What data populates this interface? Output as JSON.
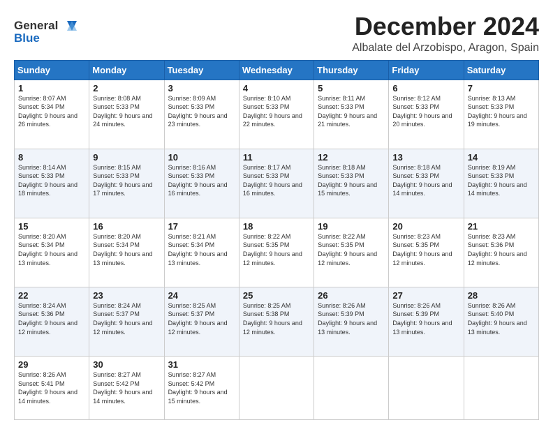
{
  "logo": {
    "line1": "General",
    "line2": "Blue"
  },
  "header": {
    "month": "December 2024",
    "location": "Albalate del Arzobispo, Aragon, Spain"
  },
  "columns": [
    "Sunday",
    "Monday",
    "Tuesday",
    "Wednesday",
    "Thursday",
    "Friday",
    "Saturday"
  ],
  "weeks": [
    [
      {
        "day": "1",
        "sunrise": "Sunrise: 8:07 AM",
        "sunset": "Sunset: 5:34 PM",
        "daylight": "Daylight: 9 hours and 26 minutes."
      },
      {
        "day": "2",
        "sunrise": "Sunrise: 8:08 AM",
        "sunset": "Sunset: 5:33 PM",
        "daylight": "Daylight: 9 hours and 24 minutes."
      },
      {
        "day": "3",
        "sunrise": "Sunrise: 8:09 AM",
        "sunset": "Sunset: 5:33 PM",
        "daylight": "Daylight: 9 hours and 23 minutes."
      },
      {
        "day": "4",
        "sunrise": "Sunrise: 8:10 AM",
        "sunset": "Sunset: 5:33 PM",
        "daylight": "Daylight: 9 hours and 22 minutes."
      },
      {
        "day": "5",
        "sunrise": "Sunrise: 8:11 AM",
        "sunset": "Sunset: 5:33 PM",
        "daylight": "Daylight: 9 hours and 21 minutes."
      },
      {
        "day": "6",
        "sunrise": "Sunrise: 8:12 AM",
        "sunset": "Sunset: 5:33 PM",
        "daylight": "Daylight: 9 hours and 20 minutes."
      },
      {
        "day": "7",
        "sunrise": "Sunrise: 8:13 AM",
        "sunset": "Sunset: 5:33 PM",
        "daylight": "Daylight: 9 hours and 19 minutes."
      }
    ],
    [
      {
        "day": "8",
        "sunrise": "Sunrise: 8:14 AM",
        "sunset": "Sunset: 5:33 PM",
        "daylight": "Daylight: 9 hours and 18 minutes."
      },
      {
        "day": "9",
        "sunrise": "Sunrise: 8:15 AM",
        "sunset": "Sunset: 5:33 PM",
        "daylight": "Daylight: 9 hours and 17 minutes."
      },
      {
        "day": "10",
        "sunrise": "Sunrise: 8:16 AM",
        "sunset": "Sunset: 5:33 PM",
        "daylight": "Daylight: 9 hours and 16 minutes."
      },
      {
        "day": "11",
        "sunrise": "Sunrise: 8:17 AM",
        "sunset": "Sunset: 5:33 PM",
        "daylight": "Daylight: 9 hours and 16 minutes."
      },
      {
        "day": "12",
        "sunrise": "Sunrise: 8:18 AM",
        "sunset": "Sunset: 5:33 PM",
        "daylight": "Daylight: 9 hours and 15 minutes."
      },
      {
        "day": "13",
        "sunrise": "Sunrise: 8:18 AM",
        "sunset": "Sunset: 5:33 PM",
        "daylight": "Daylight: 9 hours and 14 minutes."
      },
      {
        "day": "14",
        "sunrise": "Sunrise: 8:19 AM",
        "sunset": "Sunset: 5:33 PM",
        "daylight": "Daylight: 9 hours and 14 minutes."
      }
    ],
    [
      {
        "day": "15",
        "sunrise": "Sunrise: 8:20 AM",
        "sunset": "Sunset: 5:34 PM",
        "daylight": "Daylight: 9 hours and 13 minutes."
      },
      {
        "day": "16",
        "sunrise": "Sunrise: 8:20 AM",
        "sunset": "Sunset: 5:34 PM",
        "daylight": "Daylight: 9 hours and 13 minutes."
      },
      {
        "day": "17",
        "sunrise": "Sunrise: 8:21 AM",
        "sunset": "Sunset: 5:34 PM",
        "daylight": "Daylight: 9 hours and 13 minutes."
      },
      {
        "day": "18",
        "sunrise": "Sunrise: 8:22 AM",
        "sunset": "Sunset: 5:35 PM",
        "daylight": "Daylight: 9 hours and 12 minutes."
      },
      {
        "day": "19",
        "sunrise": "Sunrise: 8:22 AM",
        "sunset": "Sunset: 5:35 PM",
        "daylight": "Daylight: 9 hours and 12 minutes."
      },
      {
        "day": "20",
        "sunrise": "Sunrise: 8:23 AM",
        "sunset": "Sunset: 5:35 PM",
        "daylight": "Daylight: 9 hours and 12 minutes."
      },
      {
        "day": "21",
        "sunrise": "Sunrise: 8:23 AM",
        "sunset": "Sunset: 5:36 PM",
        "daylight": "Daylight: 9 hours and 12 minutes."
      }
    ],
    [
      {
        "day": "22",
        "sunrise": "Sunrise: 8:24 AM",
        "sunset": "Sunset: 5:36 PM",
        "daylight": "Daylight: 9 hours and 12 minutes."
      },
      {
        "day": "23",
        "sunrise": "Sunrise: 8:24 AM",
        "sunset": "Sunset: 5:37 PM",
        "daylight": "Daylight: 9 hours and 12 minutes."
      },
      {
        "day": "24",
        "sunrise": "Sunrise: 8:25 AM",
        "sunset": "Sunset: 5:37 PM",
        "daylight": "Daylight: 9 hours and 12 minutes."
      },
      {
        "day": "25",
        "sunrise": "Sunrise: 8:25 AM",
        "sunset": "Sunset: 5:38 PM",
        "daylight": "Daylight: 9 hours and 12 minutes."
      },
      {
        "day": "26",
        "sunrise": "Sunrise: 8:26 AM",
        "sunset": "Sunset: 5:39 PM",
        "daylight": "Daylight: 9 hours and 13 minutes."
      },
      {
        "day": "27",
        "sunrise": "Sunrise: 8:26 AM",
        "sunset": "Sunset: 5:39 PM",
        "daylight": "Daylight: 9 hours and 13 minutes."
      },
      {
        "day": "28",
        "sunrise": "Sunrise: 8:26 AM",
        "sunset": "Sunset: 5:40 PM",
        "daylight": "Daylight: 9 hours and 13 minutes."
      }
    ],
    [
      {
        "day": "29",
        "sunrise": "Sunrise: 8:26 AM",
        "sunset": "Sunset: 5:41 PM",
        "daylight": "Daylight: 9 hours and 14 minutes."
      },
      {
        "day": "30",
        "sunrise": "Sunrise: 8:27 AM",
        "sunset": "Sunset: 5:42 PM",
        "daylight": "Daylight: 9 hours and 14 minutes."
      },
      {
        "day": "31",
        "sunrise": "Sunrise: 8:27 AM",
        "sunset": "Sunset: 5:42 PM",
        "daylight": "Daylight: 9 hours and 15 minutes."
      },
      null,
      null,
      null,
      null
    ]
  ]
}
